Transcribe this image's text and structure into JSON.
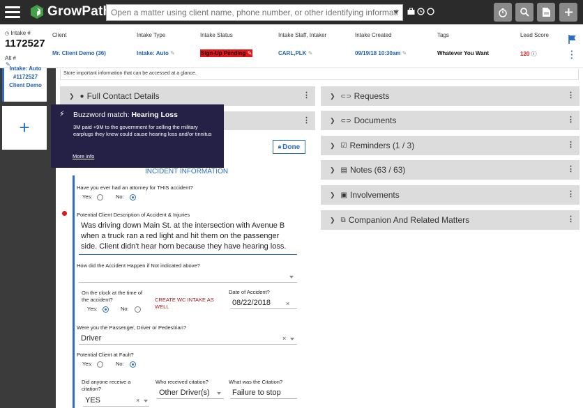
{
  "app": {
    "name": "GrowPath"
  },
  "search": {
    "placeholder": "Open a matter using client name, phone number, or other identifying information."
  },
  "colors": {
    "topbar": "#2b2b2b",
    "accent": "#2a6dc4",
    "logo_green": "#43a047",
    "status_bg": "#e4141b",
    "tooltip_bg": "#252046"
  },
  "header": {
    "intake_label": "Intake #",
    "intake_number": "1172527",
    "alt_label": "Alt #",
    "client_label": "Client",
    "client_value": "Mr. Client Demo (36)",
    "intake_type_label": "Intake Type",
    "intake_type_value": "Intake: Auto",
    "intake_status_label": "Intake Status",
    "intake_status_value": "Sign-Up Pending",
    "staff_label": "Intake Staff, Intaker",
    "staff_value": "CARL,PLK",
    "created_label": "Intake Created",
    "created_value": "09/19/18 10:30am",
    "tags_label": "Tags",
    "tags_value": "Whatever You Want",
    "lead_score_label": "Lead Score",
    "lead_score_value": "120"
  },
  "sidebar_card": {
    "line1": "Intake: Auto",
    "line2": "#1172527",
    "line3": "Client Demo",
    "add_label": "+"
  },
  "note_bar": {
    "text": "Store important information that can be accessed at a glance."
  },
  "left_panels": [
    {
      "label": "Full Contact Details"
    }
  ],
  "right_panels": [
    {
      "label": "Requests"
    },
    {
      "label": "Documents"
    },
    {
      "label": "Reminders (1 / 3)"
    },
    {
      "label": "Notes (63 / 63)"
    },
    {
      "label": "Involvements"
    },
    {
      "label": "Companion And Related Matters"
    }
  ],
  "tooltip": {
    "title_prefix": "Buzzword match: ",
    "title_bold": "Hearing Loss",
    "body": "3M paid +9M to the government for selling the military earplugs they knew could cause hearing loss and/or tinnitus",
    "link": "More info"
  },
  "form": {
    "done_label": "Done",
    "section_title": "INCIDENT INFORMATION",
    "q_attorney": "Have you ever had an attorney for THIS accident?",
    "yes": "Yes:",
    "no": "No:",
    "q_description": "Potential Client Description of Accident & Injuries",
    "description": "Was driving down Main St. at the intersection with Avenue B when a truck ran a red light and hit them on the passenger side. Client didn't hear horn because they have hearing loss.",
    "q_how": "How did the Accident Happen if Not indicated above?",
    "q_clock": "On the clock at the time of the accident?",
    "create_wc": "CREATE WC INTAKE AS WELL",
    "q_date": "Date of Accident?",
    "date_value": "08/22/2018",
    "q_role": "Were you the Passenger, Driver or Pedestrian?",
    "role_value": "Driver",
    "q_fault": "Potential Client at Fault?",
    "q_citation": "Did anyone receive a citation?",
    "citation_value": "YES",
    "q_who": "Who received citation?",
    "who_value": "Other Driver(s)",
    "q_what": "What was the Citation?",
    "what_value": "Failure to stop"
  }
}
